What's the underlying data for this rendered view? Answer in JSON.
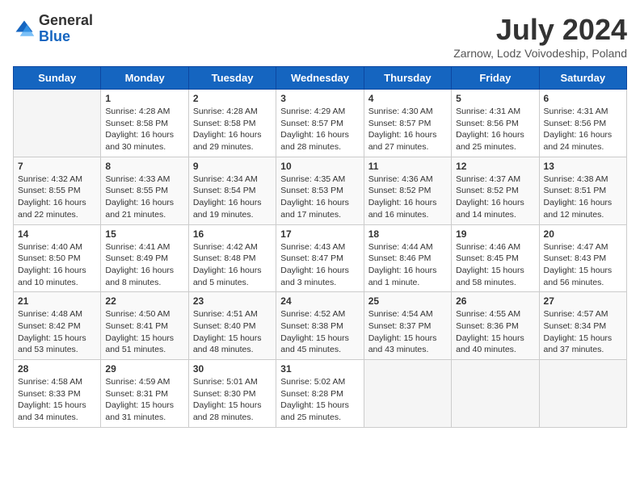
{
  "logo": {
    "general": "General",
    "blue": "Blue"
  },
  "title": "July 2024",
  "subtitle": "Zarnow, Lodz Voivodeship, Poland",
  "weekdays": [
    "Sunday",
    "Monday",
    "Tuesday",
    "Wednesday",
    "Thursday",
    "Friday",
    "Saturday"
  ],
  "weeks": [
    [
      {
        "day": "",
        "sunrise": "",
        "sunset": "",
        "daylight": ""
      },
      {
        "day": "1",
        "sunrise": "Sunrise: 4:28 AM",
        "sunset": "Sunset: 8:58 PM",
        "daylight": "Daylight: 16 hours and 30 minutes."
      },
      {
        "day": "2",
        "sunrise": "Sunrise: 4:28 AM",
        "sunset": "Sunset: 8:58 PM",
        "daylight": "Daylight: 16 hours and 29 minutes."
      },
      {
        "day": "3",
        "sunrise": "Sunrise: 4:29 AM",
        "sunset": "Sunset: 8:57 PM",
        "daylight": "Daylight: 16 hours and 28 minutes."
      },
      {
        "day": "4",
        "sunrise": "Sunrise: 4:30 AM",
        "sunset": "Sunset: 8:57 PM",
        "daylight": "Daylight: 16 hours and 27 minutes."
      },
      {
        "day": "5",
        "sunrise": "Sunrise: 4:31 AM",
        "sunset": "Sunset: 8:56 PM",
        "daylight": "Daylight: 16 hours and 25 minutes."
      },
      {
        "day": "6",
        "sunrise": "Sunrise: 4:31 AM",
        "sunset": "Sunset: 8:56 PM",
        "daylight": "Daylight: 16 hours and 24 minutes."
      }
    ],
    [
      {
        "day": "7",
        "sunrise": "Sunrise: 4:32 AM",
        "sunset": "Sunset: 8:55 PM",
        "daylight": "Daylight: 16 hours and 22 minutes."
      },
      {
        "day": "8",
        "sunrise": "Sunrise: 4:33 AM",
        "sunset": "Sunset: 8:55 PM",
        "daylight": "Daylight: 16 hours and 21 minutes."
      },
      {
        "day": "9",
        "sunrise": "Sunrise: 4:34 AM",
        "sunset": "Sunset: 8:54 PM",
        "daylight": "Daylight: 16 hours and 19 minutes."
      },
      {
        "day": "10",
        "sunrise": "Sunrise: 4:35 AM",
        "sunset": "Sunset: 8:53 PM",
        "daylight": "Daylight: 16 hours and 17 minutes."
      },
      {
        "day": "11",
        "sunrise": "Sunrise: 4:36 AM",
        "sunset": "Sunset: 8:52 PM",
        "daylight": "Daylight: 16 hours and 16 minutes."
      },
      {
        "day": "12",
        "sunrise": "Sunrise: 4:37 AM",
        "sunset": "Sunset: 8:52 PM",
        "daylight": "Daylight: 16 hours and 14 minutes."
      },
      {
        "day": "13",
        "sunrise": "Sunrise: 4:38 AM",
        "sunset": "Sunset: 8:51 PM",
        "daylight": "Daylight: 16 hours and 12 minutes."
      }
    ],
    [
      {
        "day": "14",
        "sunrise": "Sunrise: 4:40 AM",
        "sunset": "Sunset: 8:50 PM",
        "daylight": "Daylight: 16 hours and 10 minutes."
      },
      {
        "day": "15",
        "sunrise": "Sunrise: 4:41 AM",
        "sunset": "Sunset: 8:49 PM",
        "daylight": "Daylight: 16 hours and 8 minutes."
      },
      {
        "day": "16",
        "sunrise": "Sunrise: 4:42 AM",
        "sunset": "Sunset: 8:48 PM",
        "daylight": "Daylight: 16 hours and 5 minutes."
      },
      {
        "day": "17",
        "sunrise": "Sunrise: 4:43 AM",
        "sunset": "Sunset: 8:47 PM",
        "daylight": "Daylight: 16 hours and 3 minutes."
      },
      {
        "day": "18",
        "sunrise": "Sunrise: 4:44 AM",
        "sunset": "Sunset: 8:46 PM",
        "daylight": "Daylight: 16 hours and 1 minute."
      },
      {
        "day": "19",
        "sunrise": "Sunrise: 4:46 AM",
        "sunset": "Sunset: 8:45 PM",
        "daylight": "Daylight: 15 hours and 58 minutes."
      },
      {
        "day": "20",
        "sunrise": "Sunrise: 4:47 AM",
        "sunset": "Sunset: 8:43 PM",
        "daylight": "Daylight: 15 hours and 56 minutes."
      }
    ],
    [
      {
        "day": "21",
        "sunrise": "Sunrise: 4:48 AM",
        "sunset": "Sunset: 8:42 PM",
        "daylight": "Daylight: 15 hours and 53 minutes."
      },
      {
        "day": "22",
        "sunrise": "Sunrise: 4:50 AM",
        "sunset": "Sunset: 8:41 PM",
        "daylight": "Daylight: 15 hours and 51 minutes."
      },
      {
        "day": "23",
        "sunrise": "Sunrise: 4:51 AM",
        "sunset": "Sunset: 8:40 PM",
        "daylight": "Daylight: 15 hours and 48 minutes."
      },
      {
        "day": "24",
        "sunrise": "Sunrise: 4:52 AM",
        "sunset": "Sunset: 8:38 PM",
        "daylight": "Daylight: 15 hours and 45 minutes."
      },
      {
        "day": "25",
        "sunrise": "Sunrise: 4:54 AM",
        "sunset": "Sunset: 8:37 PM",
        "daylight": "Daylight: 15 hours and 43 minutes."
      },
      {
        "day": "26",
        "sunrise": "Sunrise: 4:55 AM",
        "sunset": "Sunset: 8:36 PM",
        "daylight": "Daylight: 15 hours and 40 minutes."
      },
      {
        "day": "27",
        "sunrise": "Sunrise: 4:57 AM",
        "sunset": "Sunset: 8:34 PM",
        "daylight": "Daylight: 15 hours and 37 minutes."
      }
    ],
    [
      {
        "day": "28",
        "sunrise": "Sunrise: 4:58 AM",
        "sunset": "Sunset: 8:33 PM",
        "daylight": "Daylight: 15 hours and 34 minutes."
      },
      {
        "day": "29",
        "sunrise": "Sunrise: 4:59 AM",
        "sunset": "Sunset: 8:31 PM",
        "daylight": "Daylight: 15 hours and 31 minutes."
      },
      {
        "day": "30",
        "sunrise": "Sunrise: 5:01 AM",
        "sunset": "Sunset: 8:30 PM",
        "daylight": "Daylight: 15 hours and 28 minutes."
      },
      {
        "day": "31",
        "sunrise": "Sunrise: 5:02 AM",
        "sunset": "Sunset: 8:28 PM",
        "daylight": "Daylight: 15 hours and 25 minutes."
      },
      {
        "day": "",
        "sunrise": "",
        "sunset": "",
        "daylight": ""
      },
      {
        "day": "",
        "sunrise": "",
        "sunset": "",
        "daylight": ""
      },
      {
        "day": "",
        "sunrise": "",
        "sunset": "",
        "daylight": ""
      }
    ]
  ]
}
